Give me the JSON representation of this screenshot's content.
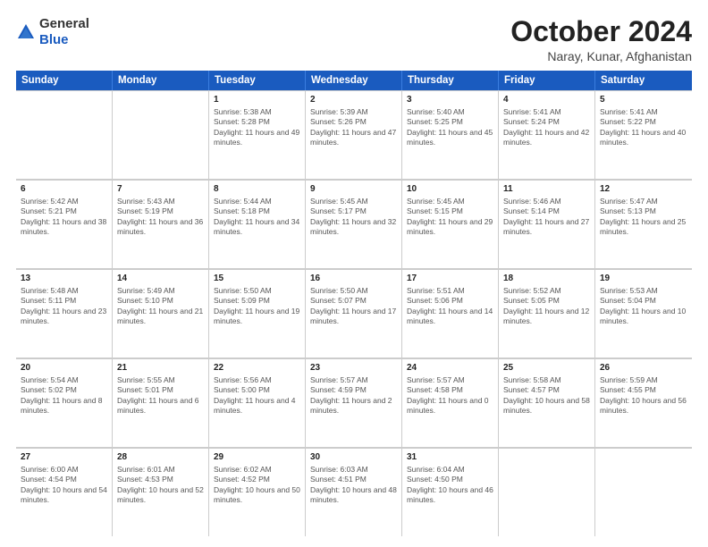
{
  "header": {
    "logo_general": "General",
    "logo_blue": "Blue",
    "month_title": "October 2024",
    "location": "Naray, Kunar, Afghanistan"
  },
  "calendar": {
    "headers": [
      "Sunday",
      "Monday",
      "Tuesday",
      "Wednesday",
      "Thursday",
      "Friday",
      "Saturday"
    ],
    "rows": [
      [
        {
          "day": "",
          "sunrise": "",
          "sunset": "",
          "daylight": ""
        },
        {
          "day": "",
          "sunrise": "",
          "sunset": "",
          "daylight": ""
        },
        {
          "day": "1",
          "sunrise": "Sunrise: 5:38 AM",
          "sunset": "Sunset: 5:28 PM",
          "daylight": "Daylight: 11 hours and 49 minutes."
        },
        {
          "day": "2",
          "sunrise": "Sunrise: 5:39 AM",
          "sunset": "Sunset: 5:26 PM",
          "daylight": "Daylight: 11 hours and 47 minutes."
        },
        {
          "day": "3",
          "sunrise": "Sunrise: 5:40 AM",
          "sunset": "Sunset: 5:25 PM",
          "daylight": "Daylight: 11 hours and 45 minutes."
        },
        {
          "day": "4",
          "sunrise": "Sunrise: 5:41 AM",
          "sunset": "Sunset: 5:24 PM",
          "daylight": "Daylight: 11 hours and 42 minutes."
        },
        {
          "day": "5",
          "sunrise": "Sunrise: 5:41 AM",
          "sunset": "Sunset: 5:22 PM",
          "daylight": "Daylight: 11 hours and 40 minutes."
        }
      ],
      [
        {
          "day": "6",
          "sunrise": "Sunrise: 5:42 AM",
          "sunset": "Sunset: 5:21 PM",
          "daylight": "Daylight: 11 hours and 38 minutes."
        },
        {
          "day": "7",
          "sunrise": "Sunrise: 5:43 AM",
          "sunset": "Sunset: 5:19 PM",
          "daylight": "Daylight: 11 hours and 36 minutes."
        },
        {
          "day": "8",
          "sunrise": "Sunrise: 5:44 AM",
          "sunset": "Sunset: 5:18 PM",
          "daylight": "Daylight: 11 hours and 34 minutes."
        },
        {
          "day": "9",
          "sunrise": "Sunrise: 5:45 AM",
          "sunset": "Sunset: 5:17 PM",
          "daylight": "Daylight: 11 hours and 32 minutes."
        },
        {
          "day": "10",
          "sunrise": "Sunrise: 5:45 AM",
          "sunset": "Sunset: 5:15 PM",
          "daylight": "Daylight: 11 hours and 29 minutes."
        },
        {
          "day": "11",
          "sunrise": "Sunrise: 5:46 AM",
          "sunset": "Sunset: 5:14 PM",
          "daylight": "Daylight: 11 hours and 27 minutes."
        },
        {
          "day": "12",
          "sunrise": "Sunrise: 5:47 AM",
          "sunset": "Sunset: 5:13 PM",
          "daylight": "Daylight: 11 hours and 25 minutes."
        }
      ],
      [
        {
          "day": "13",
          "sunrise": "Sunrise: 5:48 AM",
          "sunset": "Sunset: 5:11 PM",
          "daylight": "Daylight: 11 hours and 23 minutes."
        },
        {
          "day": "14",
          "sunrise": "Sunrise: 5:49 AM",
          "sunset": "Sunset: 5:10 PM",
          "daylight": "Daylight: 11 hours and 21 minutes."
        },
        {
          "day": "15",
          "sunrise": "Sunrise: 5:50 AM",
          "sunset": "Sunset: 5:09 PM",
          "daylight": "Daylight: 11 hours and 19 minutes."
        },
        {
          "day": "16",
          "sunrise": "Sunrise: 5:50 AM",
          "sunset": "Sunset: 5:07 PM",
          "daylight": "Daylight: 11 hours and 17 minutes."
        },
        {
          "day": "17",
          "sunrise": "Sunrise: 5:51 AM",
          "sunset": "Sunset: 5:06 PM",
          "daylight": "Daylight: 11 hours and 14 minutes."
        },
        {
          "day": "18",
          "sunrise": "Sunrise: 5:52 AM",
          "sunset": "Sunset: 5:05 PM",
          "daylight": "Daylight: 11 hours and 12 minutes."
        },
        {
          "day": "19",
          "sunrise": "Sunrise: 5:53 AM",
          "sunset": "Sunset: 5:04 PM",
          "daylight": "Daylight: 11 hours and 10 minutes."
        }
      ],
      [
        {
          "day": "20",
          "sunrise": "Sunrise: 5:54 AM",
          "sunset": "Sunset: 5:02 PM",
          "daylight": "Daylight: 11 hours and 8 minutes."
        },
        {
          "day": "21",
          "sunrise": "Sunrise: 5:55 AM",
          "sunset": "Sunset: 5:01 PM",
          "daylight": "Daylight: 11 hours and 6 minutes."
        },
        {
          "day": "22",
          "sunrise": "Sunrise: 5:56 AM",
          "sunset": "Sunset: 5:00 PM",
          "daylight": "Daylight: 11 hours and 4 minutes."
        },
        {
          "day": "23",
          "sunrise": "Sunrise: 5:57 AM",
          "sunset": "Sunset: 4:59 PM",
          "daylight": "Daylight: 11 hours and 2 minutes."
        },
        {
          "day": "24",
          "sunrise": "Sunrise: 5:57 AM",
          "sunset": "Sunset: 4:58 PM",
          "daylight": "Daylight: 11 hours and 0 minutes."
        },
        {
          "day": "25",
          "sunrise": "Sunrise: 5:58 AM",
          "sunset": "Sunset: 4:57 PM",
          "daylight": "Daylight: 10 hours and 58 minutes."
        },
        {
          "day": "26",
          "sunrise": "Sunrise: 5:59 AM",
          "sunset": "Sunset: 4:55 PM",
          "daylight": "Daylight: 10 hours and 56 minutes."
        }
      ],
      [
        {
          "day": "27",
          "sunrise": "Sunrise: 6:00 AM",
          "sunset": "Sunset: 4:54 PM",
          "daylight": "Daylight: 10 hours and 54 minutes."
        },
        {
          "day": "28",
          "sunrise": "Sunrise: 6:01 AM",
          "sunset": "Sunset: 4:53 PM",
          "daylight": "Daylight: 10 hours and 52 minutes."
        },
        {
          "day": "29",
          "sunrise": "Sunrise: 6:02 AM",
          "sunset": "Sunset: 4:52 PM",
          "daylight": "Daylight: 10 hours and 50 minutes."
        },
        {
          "day": "30",
          "sunrise": "Sunrise: 6:03 AM",
          "sunset": "Sunset: 4:51 PM",
          "daylight": "Daylight: 10 hours and 48 minutes."
        },
        {
          "day": "31",
          "sunrise": "Sunrise: 6:04 AM",
          "sunset": "Sunset: 4:50 PM",
          "daylight": "Daylight: 10 hours and 46 minutes."
        },
        {
          "day": "",
          "sunrise": "",
          "sunset": "",
          "daylight": ""
        },
        {
          "day": "",
          "sunrise": "",
          "sunset": "",
          "daylight": ""
        }
      ]
    ]
  }
}
